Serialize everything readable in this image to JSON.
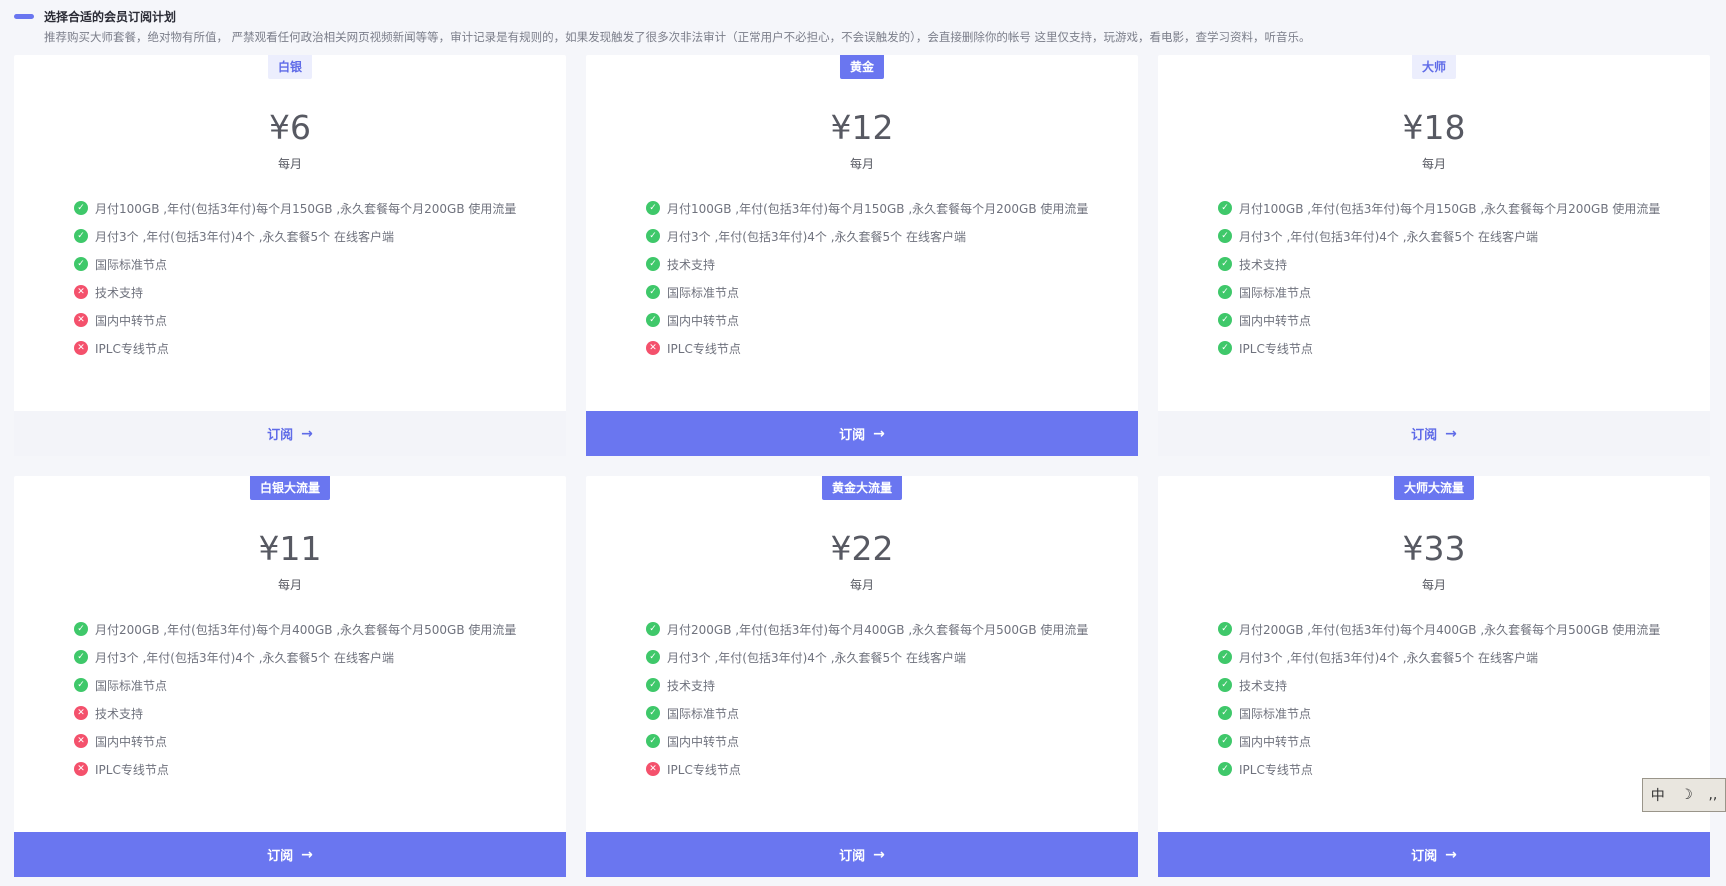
{
  "header": {
    "title": "选择合适的会员订阅计划",
    "desc": "推荐购买大师套餐，绝对物有所值， 严禁观看任何政治相关网页视频新闻等等，审计记录是有规则的，如果发现触发了很多次非法审计（正常用户不必担心，不会误触发的），会直接删除你的帐号 这里仅支持，玩游戏，看电影，查学习资料，听音乐。"
  },
  "plans": [
    {
      "name": "白银",
      "badge_style": "light",
      "price": "¥6",
      "period": "每月",
      "button": "订阅",
      "button_style": "light",
      "features": [
        {
          "text": "月付100GB ,年付(包括3年付)每个月150GB ,永久套餐每个月200GB 使用流量",
          "ok": true
        },
        {
          "text": "月付3个 ,年付(包括3年付)4个 ,永久套餐5个 在线客户端",
          "ok": true
        },
        {
          "text": "国际标准节点",
          "ok": true
        },
        {
          "text": "技术支持",
          "ok": false
        },
        {
          "text": "国内中转节点",
          "ok": false
        },
        {
          "text": "IPLC专线节点",
          "ok": false
        }
      ]
    },
    {
      "name": "黄金",
      "badge_style": "solid",
      "price": "¥12",
      "period": "每月",
      "button": "订阅",
      "button_style": "solid",
      "features": [
        {
          "text": "月付100GB ,年付(包括3年付)每个月150GB ,永久套餐每个月200GB 使用流量",
          "ok": true
        },
        {
          "text": "月付3个 ,年付(包括3年付)4个 ,永久套餐5个 在线客户端",
          "ok": true
        },
        {
          "text": "技术支持",
          "ok": true
        },
        {
          "text": "国际标准节点",
          "ok": true
        },
        {
          "text": "国内中转节点",
          "ok": true
        },
        {
          "text": "IPLC专线节点",
          "ok": false
        }
      ]
    },
    {
      "name": "大师",
      "badge_style": "light",
      "price": "¥18",
      "period": "每月",
      "button": "订阅",
      "button_style": "light",
      "features": [
        {
          "text": "月付100GB ,年付(包括3年付)每个月150GB ,永久套餐每个月200GB 使用流量",
          "ok": true
        },
        {
          "text": "月付3个 ,年付(包括3年付)4个 ,永久套餐5个 在线客户端",
          "ok": true
        },
        {
          "text": "技术支持",
          "ok": true
        },
        {
          "text": "国际标准节点",
          "ok": true
        },
        {
          "text": "国内中转节点",
          "ok": true
        },
        {
          "text": "IPLC专线节点",
          "ok": true
        }
      ]
    },
    {
      "name": "白银大流量",
      "badge_style": "solid",
      "price": "¥11",
      "period": "每月",
      "button": "订阅",
      "button_style": "solid",
      "features": [
        {
          "text": "月付200GB ,年付(包括3年付)每个月400GB ,永久套餐每个月500GB 使用流量",
          "ok": true
        },
        {
          "text": "月付3个 ,年付(包括3年付)4个 ,永久套餐5个 在线客户端",
          "ok": true
        },
        {
          "text": "国际标准节点",
          "ok": true
        },
        {
          "text": "技术支持",
          "ok": false
        },
        {
          "text": "国内中转节点",
          "ok": false
        },
        {
          "text": "IPLC专线节点",
          "ok": false
        }
      ]
    },
    {
      "name": "黄金大流量",
      "badge_style": "solid",
      "price": "¥22",
      "period": "每月",
      "button": "订阅",
      "button_style": "solid",
      "features": [
        {
          "text": "月付200GB ,年付(包括3年付)每个月400GB ,永久套餐每个月500GB 使用流量",
          "ok": true
        },
        {
          "text": "月付3个 ,年付(包括3年付)4个 ,永久套餐5个 在线客户端",
          "ok": true
        },
        {
          "text": "技术支持",
          "ok": true
        },
        {
          "text": "国际标准节点",
          "ok": true
        },
        {
          "text": "国内中转节点",
          "ok": true
        },
        {
          "text": "IPLC专线节点",
          "ok": false
        }
      ]
    },
    {
      "name": "大师大流量",
      "badge_style": "solid",
      "price": "¥33",
      "period": "每月",
      "button": "订阅",
      "button_style": "solid",
      "features": [
        {
          "text": "月付200GB ,年付(包括3年付)每个月400GB ,永久套餐每个月500GB 使用流量",
          "ok": true
        },
        {
          "text": "月付3个 ,年付(包括3年付)4个 ,永久套餐5个 在线客户端",
          "ok": true
        },
        {
          "text": "技术支持",
          "ok": true
        },
        {
          "text": "国际标准节点",
          "ok": true
        },
        {
          "text": "国内中转节点",
          "ok": true
        },
        {
          "text": "IPLC专线节点",
          "ok": true
        }
      ]
    }
  ],
  "ime": {
    "lang": "中",
    "moon": "☽",
    "punct": "‚‚"
  },
  "colors": {
    "accent": "#6a76f0",
    "ok": "#3fc86a",
    "no": "#f4516c"
  }
}
